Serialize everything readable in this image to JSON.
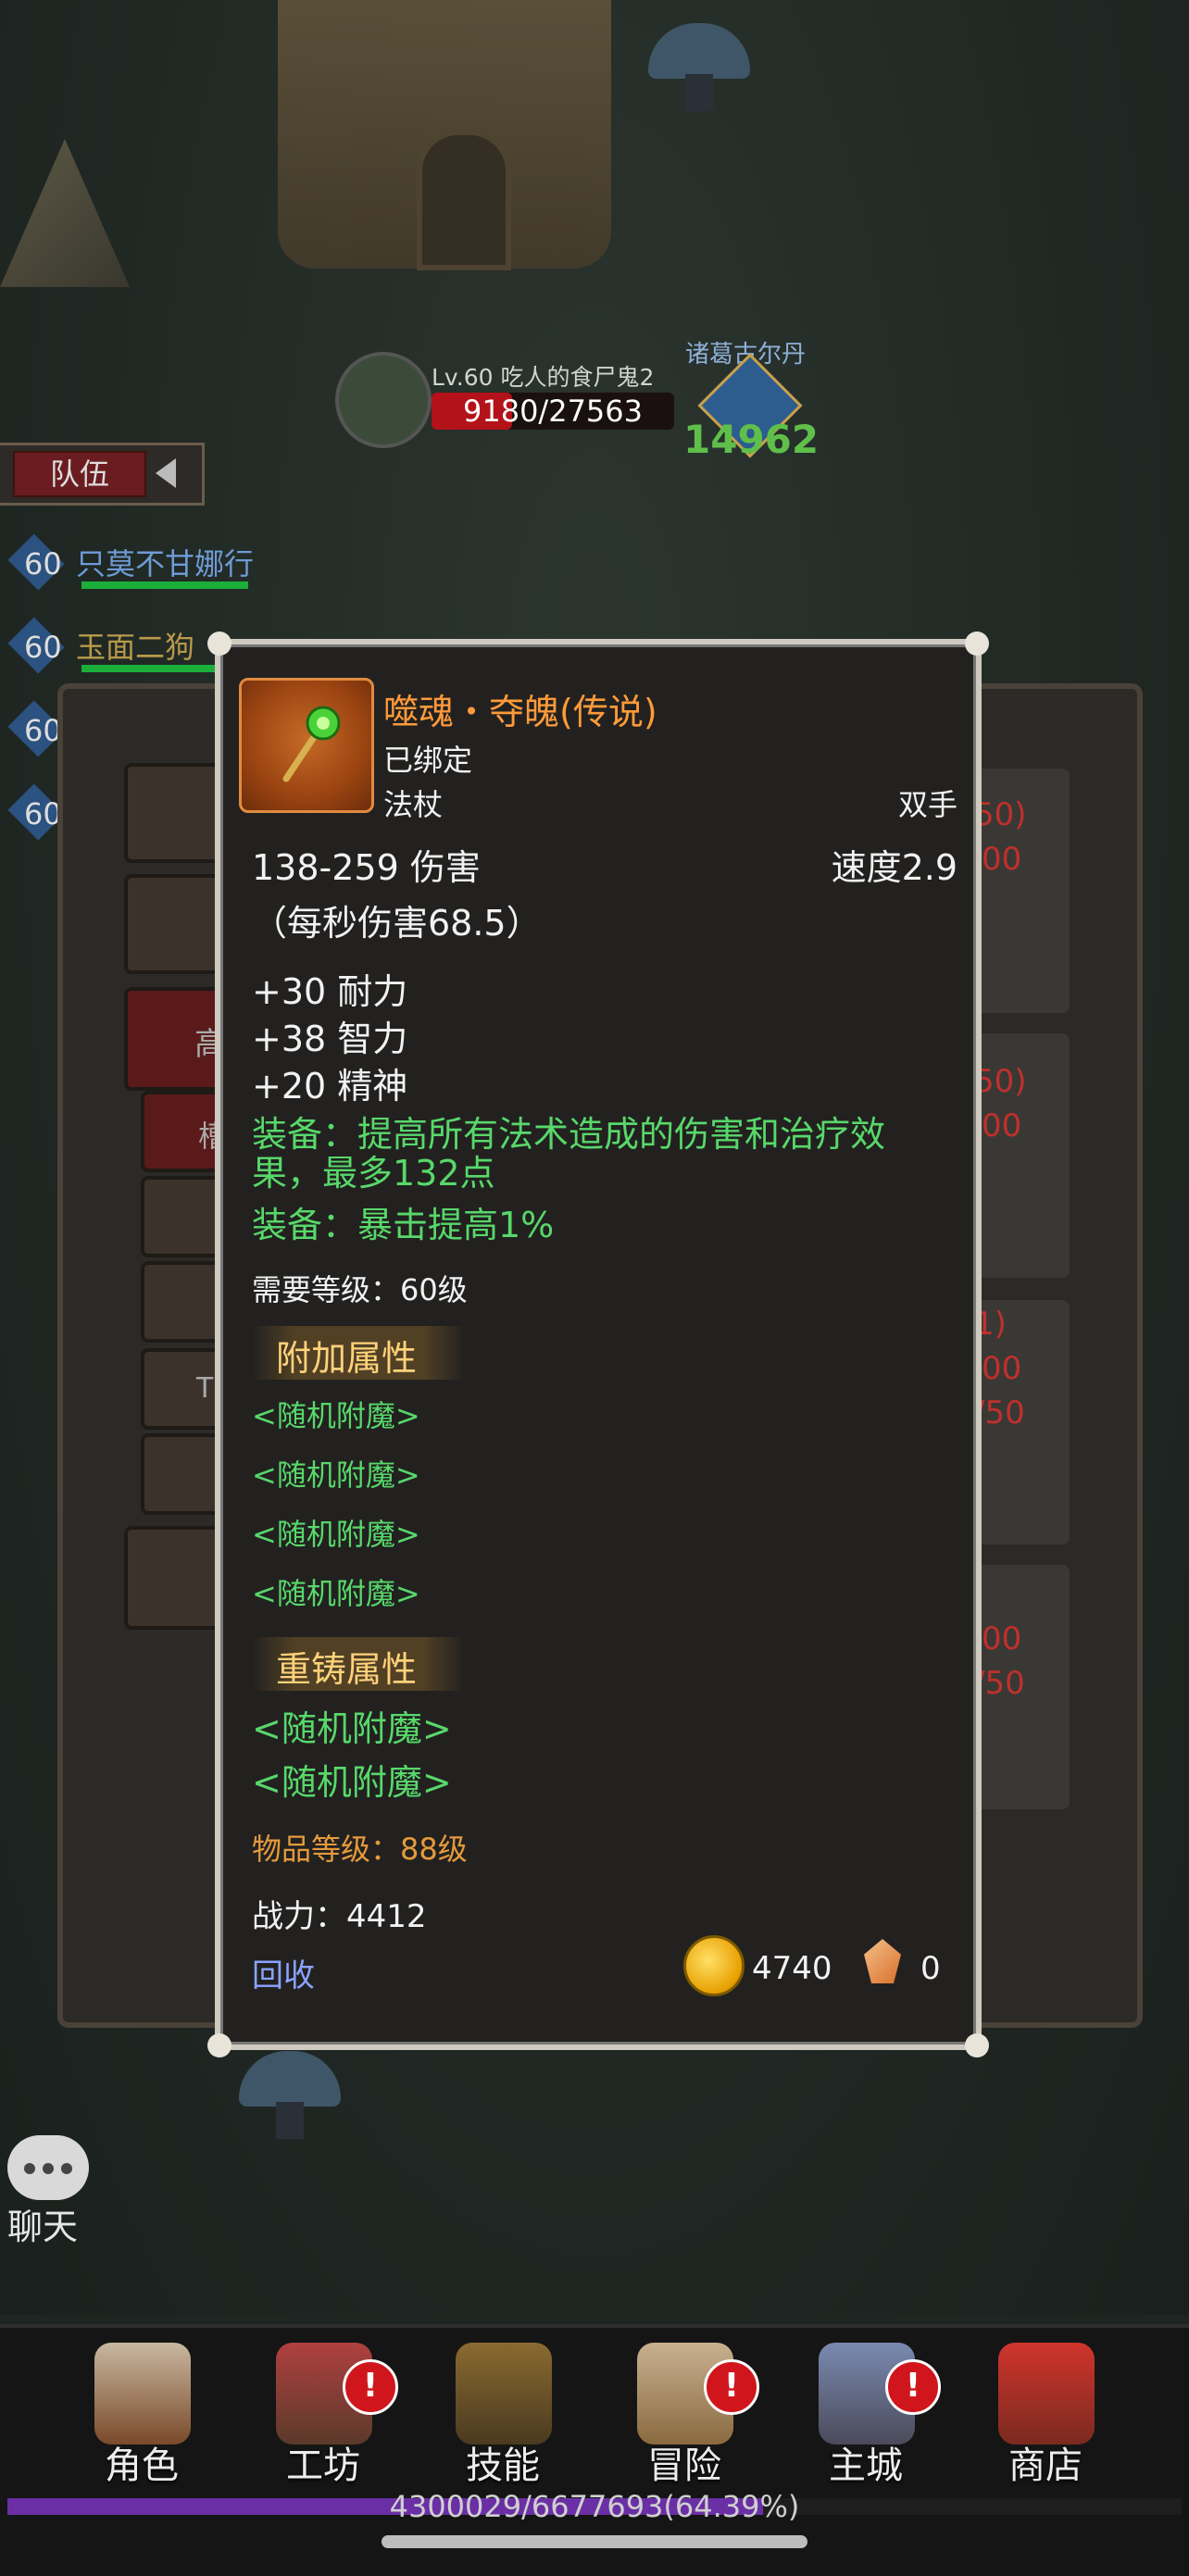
{
  "scene": {
    "boss": {
      "name": "Lv.60 吃人的食尸鬼2",
      "hp": "9180/27563",
      "hp_fraction": 0.333
    },
    "ally": {
      "name": "诸葛古尔丹",
      "damage": "14962"
    }
  },
  "team": {
    "tab_label": "队伍",
    "members": [
      {
        "level": "60",
        "name": "只莫不甘娜行"
      },
      {
        "level": "60",
        "name": "玉面二狗"
      },
      {
        "level": "60",
        "name": ""
      },
      {
        "level": "60",
        "name": ""
      }
    ]
  },
  "background_panel": {
    "right_texts": [
      "50)",
      "00",
      "50)",
      "00",
      "1)",
      "00",
      "/50",
      "00",
      "/50"
    ],
    "left_chars": [
      "高",
      "槽",
      "T"
    ]
  },
  "tooltip": {
    "item_name": "噬魂・夺魄(传说)",
    "bind_status": "已绑定",
    "item_type": "法杖",
    "slot": "双手",
    "damage": "138-259 伤害",
    "speed": "速度2.9",
    "dps": "（每秒伤害68.5）",
    "stats": [
      "+30 耐力",
      "+38 智力",
      "+20 精神"
    ],
    "equip_effects": [
      "装备：提高所有法术造成的伤害和治疗效",
      "果，最多132点",
      "装备：暴击提高1%"
    ],
    "required_level": "需要等级：60级",
    "additional_title": "附加属性",
    "additional": [
      "<随机附魔>",
      "<随机附魔>",
      "<随机附魔>",
      "<随机附魔>"
    ],
    "reforge_title": "重铸属性",
    "reforge": [
      "<随机附魔>",
      "<随机附魔>"
    ],
    "item_level": "物品等级：88级",
    "power": "战力：4412",
    "recycle": "回收",
    "gold": "4740",
    "gems": "0"
  },
  "chat": {
    "label": "聊天"
  },
  "nav": [
    {
      "label": "角色",
      "badge": ""
    },
    {
      "label": "工坊",
      "badge": "!"
    },
    {
      "label": "技能",
      "badge": ""
    },
    {
      "label": "冒险",
      "badge": "!"
    },
    {
      "label": "主城",
      "badge": "!"
    },
    {
      "label": "商店",
      "badge": ""
    }
  ],
  "experience": {
    "text": "4300029/6677693(64.39%)",
    "fraction": 0.6439
  },
  "colors": {
    "legendary": "#ff9a3a",
    "green_text": "#58d86a",
    "gold_text": "#e59a3c",
    "hp_red": "#b3121a",
    "xp_purple": "#6a2fa5"
  }
}
